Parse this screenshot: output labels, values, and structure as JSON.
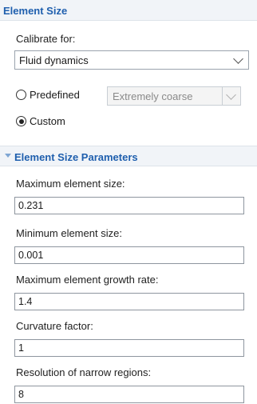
{
  "section1": {
    "title": "Element Size",
    "calibrate_label": "Calibrate for:",
    "calibrate_value": "Fluid dynamics",
    "predefined_label": "Predefined",
    "predefined_value": "Extremely coarse",
    "custom_label": "Custom",
    "selected_option": "Custom"
  },
  "section2": {
    "title": "Element Size Parameters",
    "fields": [
      {
        "label": "Maximum element size:",
        "value": "0.231"
      },
      {
        "label": "Minimum element size:",
        "value": "0.001"
      },
      {
        "label": "Maximum element growth rate:",
        "value": "1.4"
      },
      {
        "label": "Curvature factor:",
        "value": "1"
      },
      {
        "label": "Resolution of narrow regions:",
        "value": "8"
      }
    ]
  },
  "colors": {
    "header_title": "#1f5fae",
    "header_bg": "#f1f4f8"
  },
  "icons": {
    "expand": "triangle-down-icon",
    "dropdown": "chevron-down-icon"
  }
}
